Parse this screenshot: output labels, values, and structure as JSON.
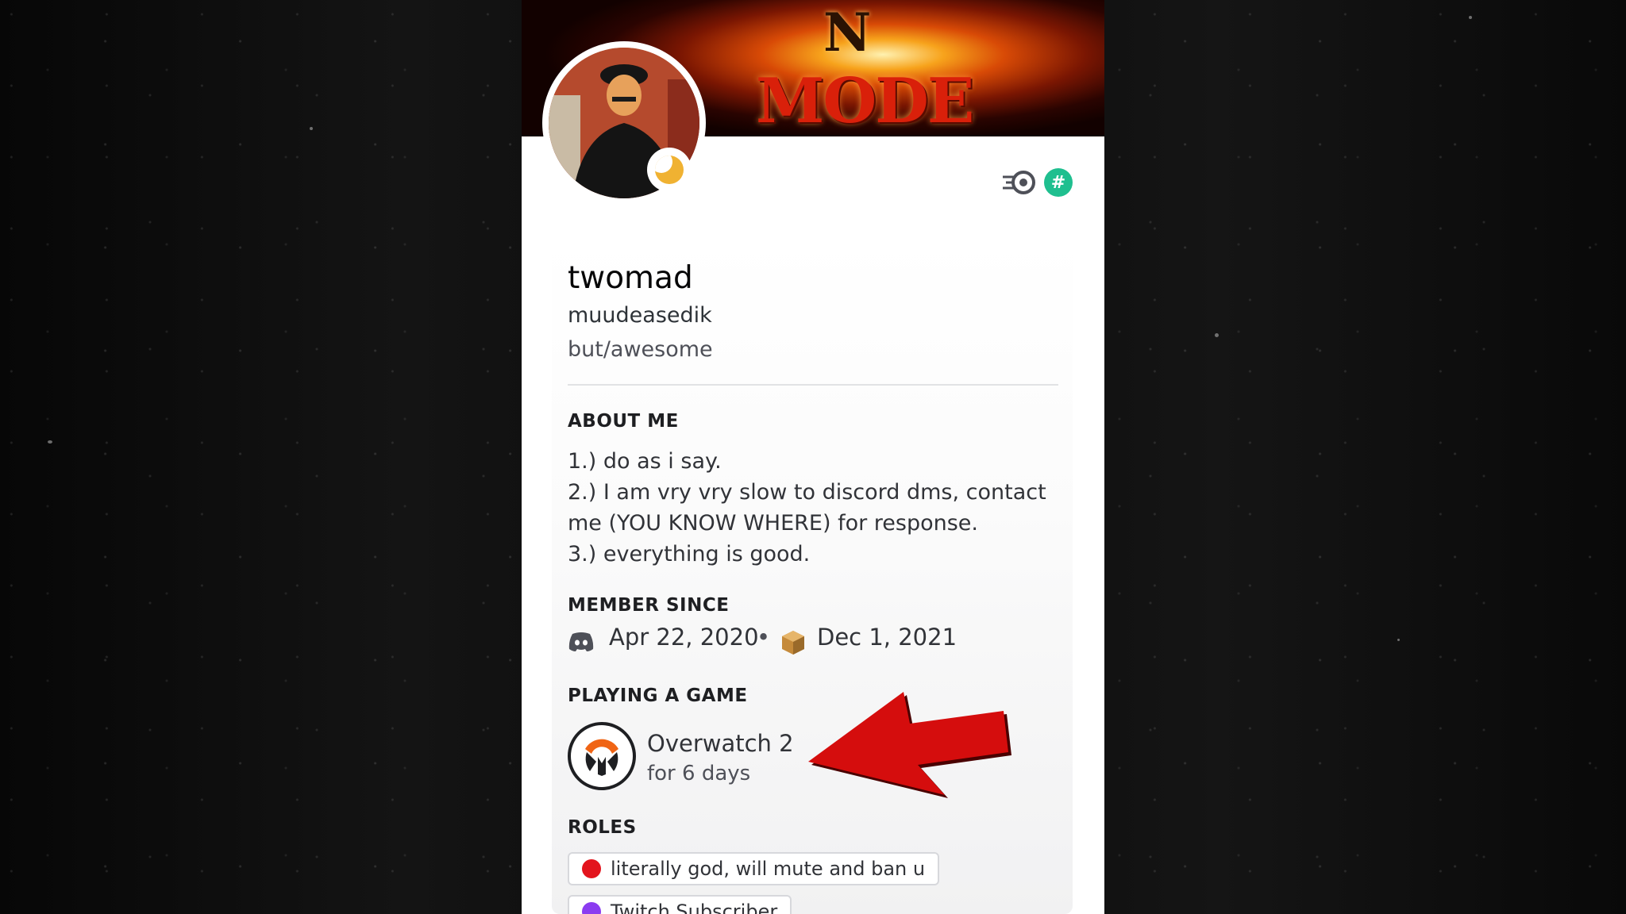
{
  "banner": {
    "letter": "N",
    "word": "MODE"
  },
  "profile": {
    "display_name": "twomad",
    "username": "muudeasedik",
    "pronouns": "but/awesome"
  },
  "about": {
    "title": "ABOUT ME",
    "lines": [
      "1.) do as i say.",
      "2.) I am vry vry slow to discord dms, contact",
      "me (YOU KNOW WHERE) for response.",
      "3.) everything is good."
    ]
  },
  "member_since": {
    "title": "MEMBER SINCE",
    "discord_date": "Apr 22, 2020",
    "separator": "•",
    "server_date": "Dec 1, 2021"
  },
  "game": {
    "title": "PLAYING A GAME",
    "name": "Overwatch 2",
    "duration": "for 6 days"
  },
  "roles": {
    "title": "ROLES",
    "items": [
      {
        "label": "literally god, will mute and ban u",
        "color": "#e3141d"
      },
      {
        "label": "Twitch Subscriber",
        "color": "#8b3cf0"
      }
    ]
  },
  "badges": {
    "hash_symbol": "#"
  },
  "colors": {
    "status_idle": "#f0b232",
    "badge_green": "#1fbf8f",
    "arrow_red": "#d50d0d"
  }
}
